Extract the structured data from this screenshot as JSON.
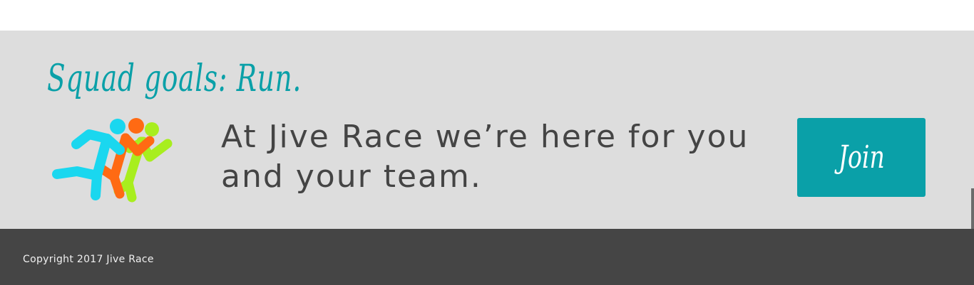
{
  "promo": {
    "tagline": "Squad goals: Run.",
    "message": "At Jive Race we’re here for you and your team.",
    "join_label": "Join",
    "logo_icon": "running-team-icon"
  },
  "footer": {
    "copyright": "Copyright 2017 Jive Race"
  },
  "colors": {
    "accent": "#0aa0a8",
    "promo_background": "#dddddd",
    "footer_background": "#454545",
    "runner_cyan": "#1ad7ef",
    "runner_orange": "#ff6a13",
    "runner_green": "#a8ee1e"
  }
}
